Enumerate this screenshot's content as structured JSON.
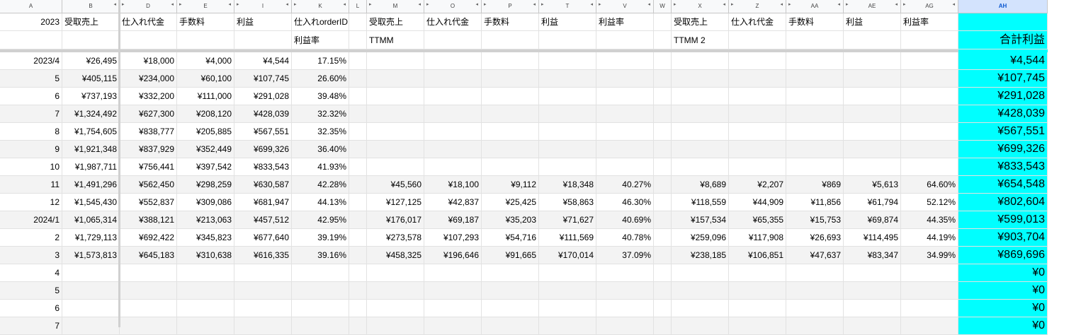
{
  "columns": [
    {
      "letter": "A",
      "w": 88
    },
    {
      "letter": "B",
      "w": 81
    },
    {
      "letter": "D",
      "w": 81
    },
    {
      "letter": "E",
      "w": 81
    },
    {
      "letter": "I",
      "w": 81
    },
    {
      "letter": "K",
      "w": 81
    },
    {
      "letter": "L",
      "w": 25
    },
    {
      "letter": "M",
      "w": 81
    },
    {
      "letter": "O",
      "w": 81
    },
    {
      "letter": "P",
      "w": 81
    },
    {
      "letter": "T",
      "w": 81
    },
    {
      "letter": "V",
      "w": 81
    },
    {
      "letter": "W",
      "w": 25
    },
    {
      "letter": "X",
      "w": 81
    },
    {
      "letter": "Z",
      "w": 81
    },
    {
      "letter": "AA",
      "w": 81
    },
    {
      "letter": "AE",
      "w": 81
    },
    {
      "letter": "AG",
      "w": 81
    },
    {
      "letter": "AH",
      "w": 126
    }
  ],
  "header_row1": [
    "2023",
    "受取売上",
    "仕入れ代金",
    "手数料",
    "利益",
    "仕入れorderID",
    "",
    "受取売上",
    "仕入れ代金",
    "手数料",
    "利益",
    "利益率",
    "",
    "受取売上",
    "仕入れ代金",
    "手数料",
    "利益",
    "利益率",
    ""
  ],
  "header_row2": [
    "",
    "",
    "",
    "",
    "",
    "利益率",
    "",
    "TTMM",
    "",
    "",
    "",
    "",
    "",
    "TTMM 2",
    "",
    "",
    "",
    "",
    "合計利益"
  ],
  "rows": [
    [
      "2023/4",
      "¥26,495",
      "¥18,000",
      "¥4,000",
      "¥4,544",
      "17.15%",
      "",
      "",
      "",
      "",
      "",
      "",
      "",
      "",
      "",
      "",
      "",
      "",
      "¥4,544"
    ],
    [
      "5",
      "¥405,115",
      "¥234,000",
      "¥60,100",
      "¥107,745",
      "26.60%",
      "",
      "",
      "",
      "",
      "",
      "",
      "",
      "",
      "",
      "",
      "",
      "",
      "¥107,745"
    ],
    [
      "6",
      "¥737,193",
      "¥332,200",
      "¥111,000",
      "¥291,028",
      "39.48%",
      "",
      "",
      "",
      "",
      "",
      "",
      "",
      "",
      "",
      "",
      "",
      "",
      "¥291,028"
    ],
    [
      "7",
      "¥1,324,492",
      "¥627,300",
      "¥208,120",
      "¥428,039",
      "32.32%",
      "",
      "",
      "",
      "",
      "",
      "",
      "",
      "",
      "",
      "",
      "",
      "",
      "¥428,039"
    ],
    [
      "8",
      "¥1,754,605",
      "¥838,777",
      "¥205,885",
      "¥567,551",
      "32.35%",
      "",
      "",
      "",
      "",
      "",
      "",
      "",
      "",
      "",
      "",
      "",
      "",
      "¥567,551"
    ],
    [
      "9",
      "¥1,921,348",
      "¥837,929",
      "¥352,449",
      "¥699,326",
      "36.40%",
      "",
      "",
      "",
      "",
      "",
      "",
      "",
      "",
      "",
      "",
      "",
      "",
      "¥699,326"
    ],
    [
      "10",
      "¥1,987,711",
      "¥756,441",
      "¥397,542",
      "¥833,543",
      "41.93%",
      "",
      "",
      "",
      "",
      "",
      "",
      "",
      "",
      "",
      "",
      "",
      "",
      "¥833,543"
    ],
    [
      "11",
      "¥1,491,296",
      "¥562,450",
      "¥298,259",
      "¥630,587",
      "42.28%",
      "",
      "¥45,560",
      "¥18,100",
      "¥9,112",
      "¥18,348",
      "40.27%",
      "",
      "¥8,689",
      "¥2,207",
      "¥869",
      "¥5,613",
      "64.60%",
      "¥654,548"
    ],
    [
      "12",
      "¥1,545,430",
      "¥552,837",
      "¥309,086",
      "¥681,947",
      "44.13%",
      "",
      "¥127,125",
      "¥42,837",
      "¥25,425",
      "¥58,863",
      "46.30%",
      "",
      "¥118,559",
      "¥44,909",
      "¥11,856",
      "¥61,794",
      "52.12%",
      "¥802,604"
    ],
    [
      "2024/1",
      "¥1,065,314",
      "¥388,121",
      "¥213,063",
      "¥457,512",
      "42.95%",
      "",
      "¥176,017",
      "¥69,187",
      "¥35,203",
      "¥71,627",
      "40.69%",
      "",
      "¥157,534",
      "¥65,355",
      "¥15,753",
      "¥69,874",
      "44.35%",
      "¥599,013"
    ],
    [
      "2",
      "¥1,729,113",
      "¥692,422",
      "¥345,823",
      "¥677,640",
      "39.19%",
      "",
      "¥273,578",
      "¥107,293",
      "¥54,716",
      "¥111,569",
      "40.78%",
      "",
      "¥259,096",
      "¥117,908",
      "¥26,693",
      "¥114,495",
      "44.19%",
      "¥903,704"
    ],
    [
      "3",
      "¥1,573,813",
      "¥645,183",
      "¥310,638",
      "¥616,335",
      "39.16%",
      "",
      "¥458,325",
      "¥196,646",
      "¥91,665",
      "¥170,014",
      "37.09%",
      "",
      "¥238,185",
      "¥106,851",
      "¥47,637",
      "¥83,347",
      "34.99%",
      "¥869,696"
    ],
    [
      "4",
      "",
      "",
      "",
      "",
      "",
      "",
      "",
      "",
      "",
      "",
      "",
      "",
      "",
      "",
      "",
      "",
      "",
      "¥0"
    ],
    [
      "5",
      "",
      "",
      "",
      "",
      "",
      "",
      "",
      "",
      "",
      "",
      "",
      "",
      "",
      "",
      "",
      "",
      "",
      "¥0"
    ],
    [
      "6",
      "",
      "",
      "",
      "",
      "",
      "",
      "",
      "",
      "",
      "",
      "",
      "",
      "",
      "",
      "",
      "",
      "",
      "¥0"
    ],
    [
      "7",
      "",
      "",
      "",
      "",
      "",
      "",
      "",
      "",
      "",
      "",
      "",
      "",
      "",
      "",
      "",
      "",
      "",
      "¥0"
    ]
  ],
  "colors": {
    "total_column": "#00ffff",
    "selected_header": "#d3e3fd",
    "band": "#f3f3f3"
  }
}
